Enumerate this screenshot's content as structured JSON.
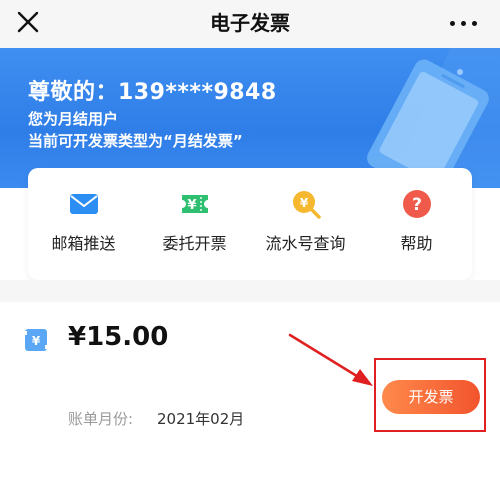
{
  "nav": {
    "title": "电子发票"
  },
  "banner": {
    "greeting": "尊敬的：139****9848",
    "user_type": "您为月结用户",
    "invoice_type": "当前可开发票类型为“月结发票”"
  },
  "menu": {
    "items": [
      {
        "label": "邮箱推送",
        "icon": "mail-icon"
      },
      {
        "label": "委托开票",
        "icon": "yuan-ticket-icon"
      },
      {
        "label": "流水号查询",
        "icon": "search-yuan-icon"
      },
      {
        "label": "帮助",
        "icon": "help-icon"
      }
    ]
  },
  "bill": {
    "amount": "¥15.00",
    "month_label": "账单月份:",
    "month_value": "2021年02月",
    "button_label": "开发票"
  },
  "colors": {
    "banner_blue": "#2f7ee8",
    "button_orange": "#f2542d",
    "highlight_red": "#e02020"
  }
}
